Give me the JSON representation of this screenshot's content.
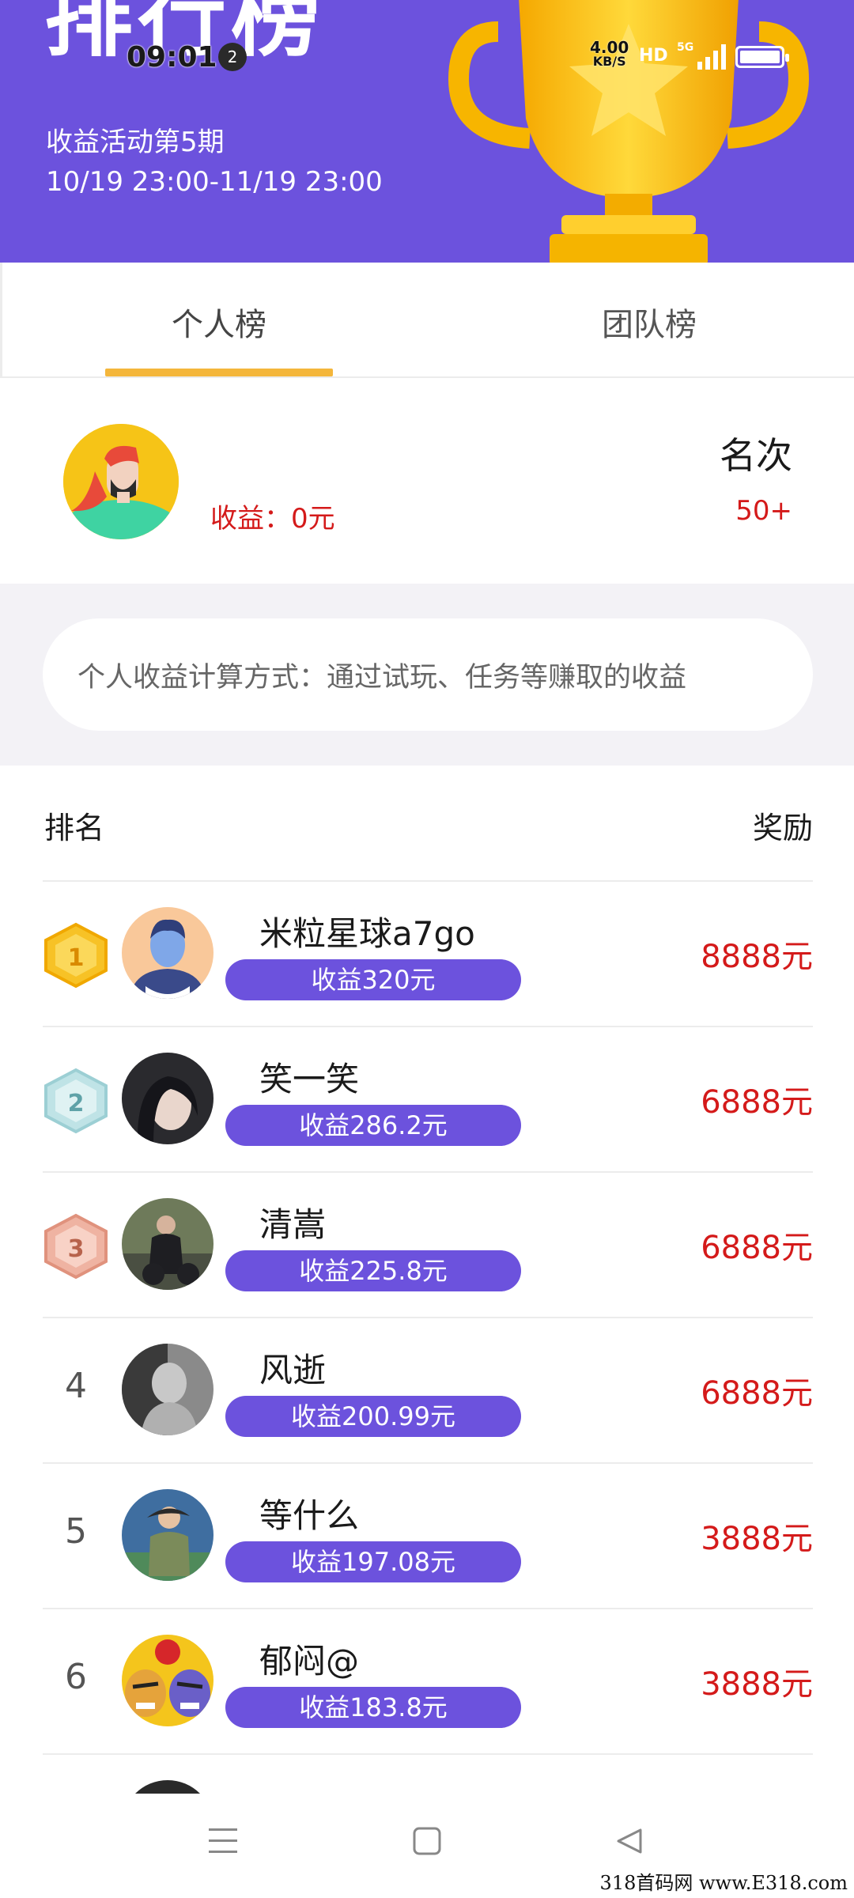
{
  "header": {
    "title": "排行榜",
    "activity_period": "收益活动第5期",
    "activity_dates": "10/19 23:00-11/19 23:00"
  },
  "status_bar": {
    "time": "09:01",
    "notification_count": "2",
    "speed_value": "4.00",
    "speed_unit": "KB/S",
    "hd": "HD",
    "network": "5G"
  },
  "tabs": [
    {
      "label": "个人榜",
      "active": true
    },
    {
      "label": "团队榜",
      "active": false
    }
  ],
  "my_rank": {
    "income": "收益：0元",
    "rank_label": "名次",
    "rank_value": "50+"
  },
  "info": {
    "text": "个人收益计算方式：通过试玩、任务等赚取的收益"
  },
  "list_header": {
    "rank": "排名",
    "reward": "奖励"
  },
  "rows": [
    {
      "rank": "1",
      "name": "米粒星球a7go",
      "income": "收益320元",
      "reward": "8888元"
    },
    {
      "rank": "2",
      "name": "笑一笑",
      "income": "收益286.2元",
      "reward": "6888元"
    },
    {
      "rank": "3",
      "name": "清嵩",
      "income": "收益225.8元",
      "reward": "6888元"
    },
    {
      "rank": "4",
      "name": "风逝",
      "income": "收益200.99元",
      "reward": "6888元"
    },
    {
      "rank": "5",
      "name": "等什么",
      "income": "收益197.08元",
      "reward": "3888元"
    },
    {
      "rank": "6",
      "name": "郁闷@",
      "income": "收益183.8元",
      "reward": "3888元"
    }
  ],
  "watermark": "318首码网  www.E318.com",
  "colors": {
    "brand_purple": "#6c52dd",
    "accent_gold": "#f4b63b",
    "reward_red": "#d41a1a"
  },
  "icons": {
    "trophy": "trophy-icon",
    "medal_gold": "gold-medal-icon",
    "medal_silver": "silver-medal-icon",
    "medal_bronze": "bronze-medal-icon",
    "nav_menu": "menu-icon",
    "nav_home": "home-icon",
    "nav_back": "back-icon"
  }
}
